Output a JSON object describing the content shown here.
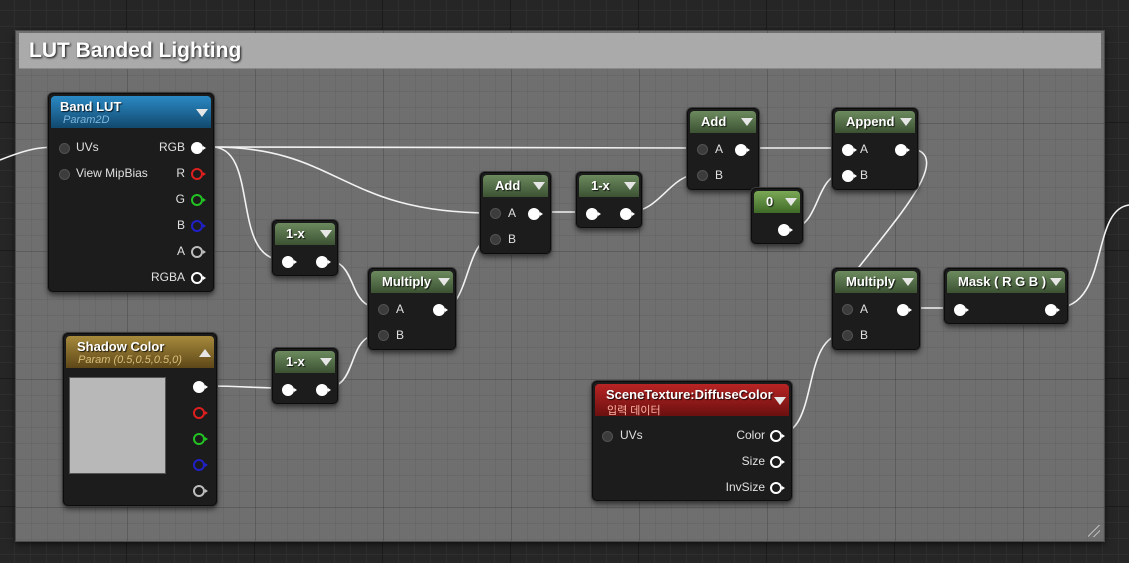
{
  "comment": {
    "title": "LUT Banded Lighting"
  },
  "colors": {
    "pin_r": "#dd1f1f",
    "pin_g": "#22c322",
    "pin_b": "#2020c8",
    "pin_a": "#bdbdbd",
    "pin_white": "#ffffff"
  },
  "nodes": {
    "band_lut": {
      "title": "Band LUT",
      "subtitle": "Param2D",
      "inputs": [
        "UVs",
        "View MipBias"
      ],
      "outputs": [
        "RGB",
        "R",
        "G",
        "B",
        "A",
        "RGBA"
      ]
    },
    "shadow_color": {
      "title": "Shadow Color",
      "subtitle": "Param (0.5,0.5,0.5,0)"
    },
    "one_minus_1": {
      "title": "1-x"
    },
    "one_minus_2": {
      "title": "1-x"
    },
    "one_minus_3": {
      "title": "1-x"
    },
    "multiply_1": {
      "title": "Multiply",
      "inputs": [
        "A",
        "B"
      ]
    },
    "add_1": {
      "title": "Add",
      "inputs": [
        "A",
        "B"
      ]
    },
    "add_2": {
      "title": "Add",
      "inputs": [
        "A",
        "B"
      ]
    },
    "const_0": {
      "title": "0"
    },
    "append": {
      "title": "Append",
      "inputs": [
        "A",
        "B"
      ]
    },
    "multiply_2": {
      "title": "Multiply",
      "inputs": [
        "A",
        "B"
      ]
    },
    "mask": {
      "title": "Mask ( R G B )"
    },
    "scene_texture": {
      "title": "SceneTexture:DiffuseColor",
      "subtitle": "입력 데이터",
      "inputs": [
        "UVs"
      ],
      "outputs": [
        "Color",
        "Size",
        "InvSize"
      ]
    }
  }
}
